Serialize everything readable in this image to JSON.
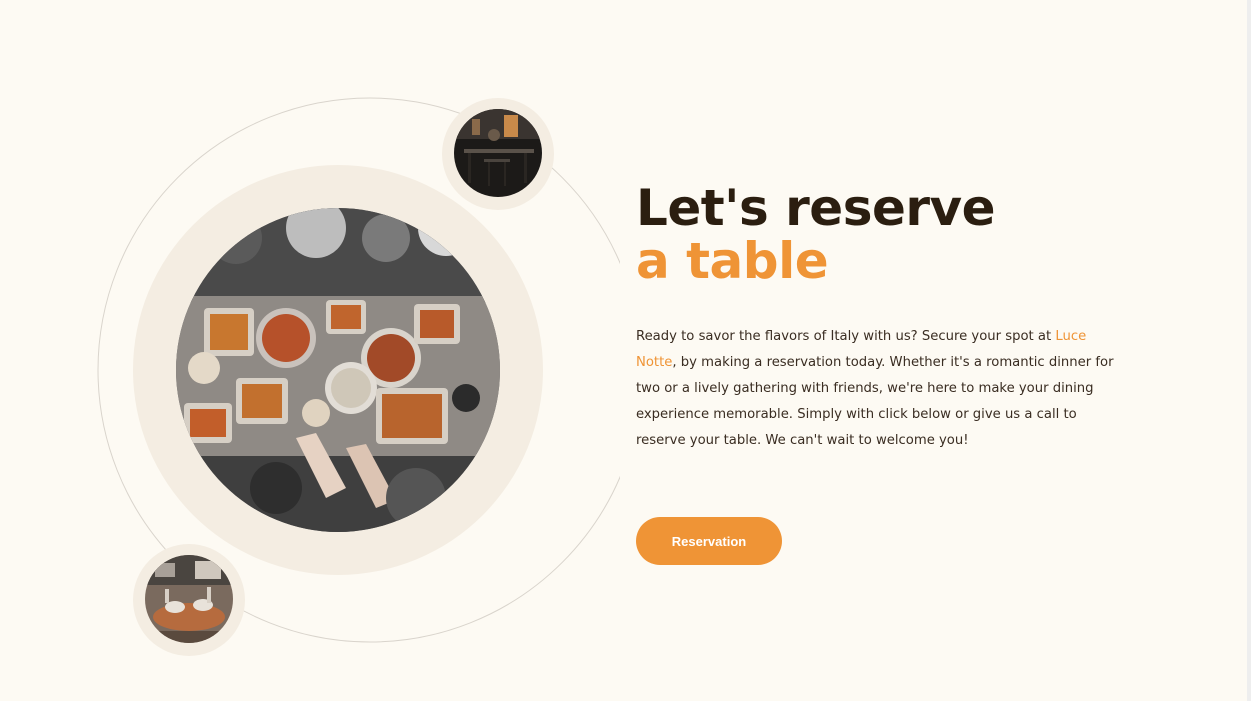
{
  "reservation": {
    "heading_line1": "Let's reserve",
    "heading_line2": "a table",
    "description_part1": "Ready to savor the flavors of Italy with us? Secure your spot at ",
    "brand_name": "Luce Notte",
    "description_part2": ", by making a reservation today. Whether it's a romantic dinner for two or a lively gathering with friends, we're here to make your dining experience memorable. Simply with click below or give us a call to reserve your table. We can't wait to welcome you!",
    "button_label": "Reservation"
  },
  "images": {
    "main": "photo-table-food-overhead",
    "top": "photo-restaurant-interior-dark",
    "bottom": "photo-restaurant-table-setting"
  },
  "colors": {
    "background": "#fdfaf3",
    "accent": "#ef9436",
    "heading": "#2b1e10",
    "text": "#3a2d22",
    "halo": "#f4ede2"
  }
}
